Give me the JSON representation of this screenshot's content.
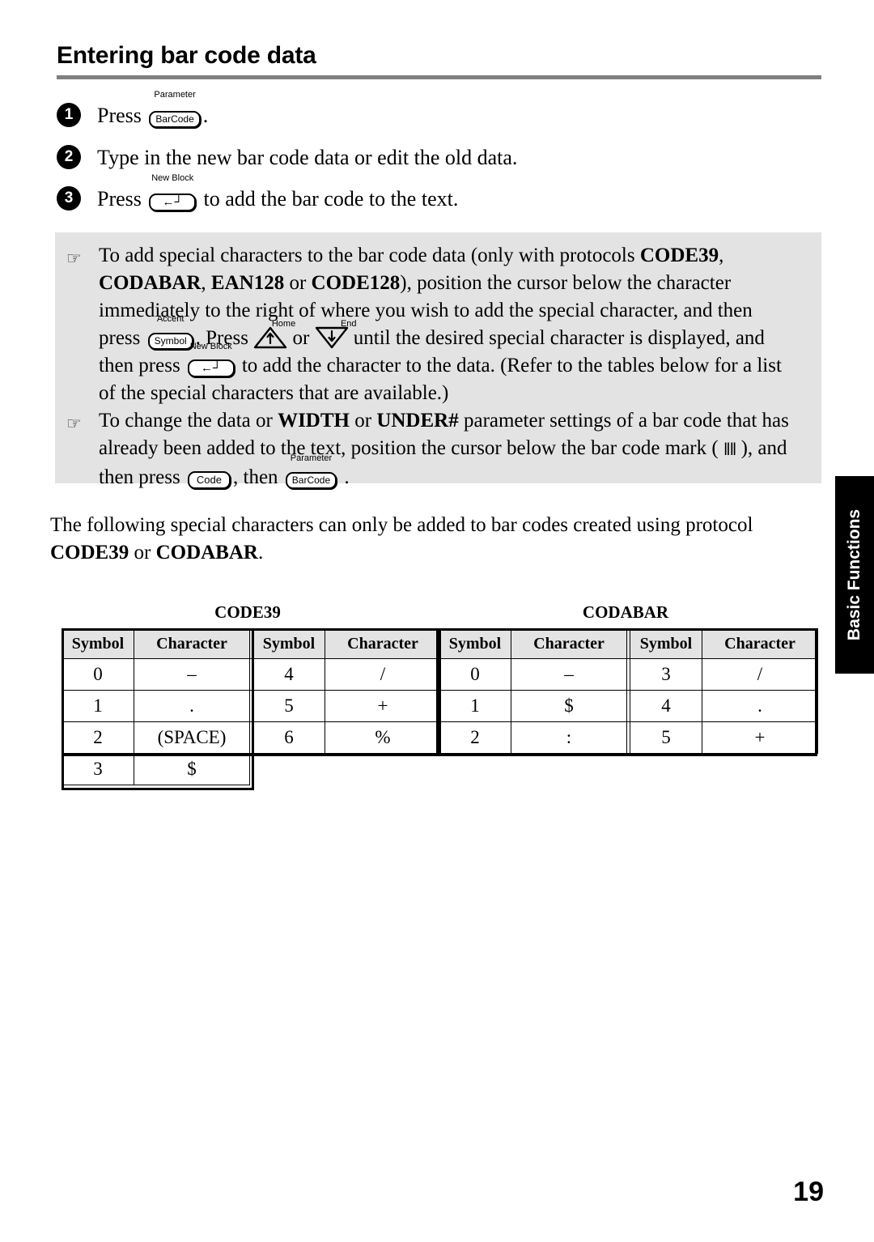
{
  "page": {
    "heading": "Entering bar code data",
    "number": "19",
    "side_tab": "Basic Functions",
    "accent_color": "#000000",
    "note_background": "#e3e3e3",
    "rule_color": "#808080"
  },
  "steps": [
    {
      "num": "1",
      "pre": "Press",
      "key": {
        "label": "Parameter",
        "cap": "BarCode"
      },
      "post": "."
    },
    {
      "num": "2",
      "text": "Type in the new bar code data or edit the old data."
    },
    {
      "num": "3",
      "pre": "Press",
      "key": {
        "label": "New Block",
        "cap": "←┘"
      },
      "post": "to add the bar code to the text."
    }
  ],
  "notes": [
    {
      "marker": "☞",
      "lines": [
        {
          "segments": [
            {
              "t": "To add special characters to the bar code data (only with protocols "
            },
            {
              "t": "CODE39",
              "bold": true
            },
            {
              "t": ","
            }
          ]
        },
        {
          "segments": [
            {
              "t": "CODABAR",
              "bold": true
            },
            {
              "t": ", "
            },
            {
              "t": "EAN128",
              "bold": true
            },
            {
              "t": " or "
            },
            {
              "t": "CODE128",
              "bold": true
            },
            {
              "t": "), position the cursor below the character"
            }
          ]
        },
        {
          "segments": [
            {
              "t": "immediately to the right of where you wish to add the special character, and then"
            }
          ]
        },
        {
          "segments": [
            {
              "t": "press "
            },
            {
              "key": {
                "label": "Accent",
                "cap": "Symbol"
              }
            },
            {
              "t": ". Press "
            },
            {
              "arrow": {
                "label": "Home",
                "dir": "up"
              }
            },
            {
              "t": " or "
            },
            {
              "arrow": {
                "label": "End",
                "dir": "down"
              }
            },
            {
              "t": " until the desired special character is displayed, and"
            }
          ]
        },
        {
          "segments": [
            {
              "t": "then press "
            },
            {
              "key": {
                "label": "New Block",
                "cap": "←┘"
              }
            },
            {
              "t": " to add the character to the data. (Refer to the tables below for a list"
            }
          ]
        },
        {
          "segments": [
            {
              "t": "of the special characters that are available.)"
            }
          ]
        }
      ]
    },
    {
      "marker": "☞",
      "lines": [
        {
          "segments": [
            {
              "t": "To change the data or "
            },
            {
              "t": "WIDTH",
              "bold": true
            },
            {
              "t": " or "
            },
            {
              "t": "UNDER#",
              "bold": true
            },
            {
              "t": " parameter settings of a bar code that has"
            }
          ]
        },
        {
          "segments": [
            {
              "t": "already been added to the text, position the cursor below the bar code mark ( "
            },
            {
              "barmark": "‖‖"
            },
            {
              "t": " ), and"
            }
          ]
        },
        {
          "segments": [
            {
              "t": "then press "
            },
            {
              "key": {
                "cap": "Code"
              }
            },
            {
              "t": ", then "
            },
            {
              "key": {
                "label": "Parameter",
                "cap": "BarCode"
              }
            },
            {
              "t": " ."
            }
          ]
        }
      ]
    }
  ],
  "intro": {
    "line1": "The following special characters can only be added to bar codes created using protocol",
    "line2_a": "CODE39",
    "line2_b": " or ",
    "line2_c": "CODABAR",
    "line2_d": "."
  },
  "tables": [
    {
      "id": "code39",
      "title": "CODE39",
      "headers": [
        "Symbol",
        "Character",
        "Symbol",
        "Character"
      ],
      "rows": [
        [
          "0",
          "–",
          "4",
          "/"
        ],
        [
          "1",
          ".",
          "5",
          "+"
        ],
        [
          "2",
          "(SPACE)",
          "6",
          "%"
        ],
        [
          "3",
          "$",
          "",
          ""
        ]
      ]
    },
    {
      "id": "codabar",
      "title": "CODABAR",
      "headers": [
        "Symbol",
        "Character",
        "Symbol",
        "Character"
      ],
      "rows": [
        [
          "0",
          "–",
          "3",
          "/"
        ],
        [
          "1",
          "$",
          "4",
          "."
        ],
        [
          "2",
          ":",
          "5",
          "+"
        ]
      ]
    }
  ]
}
